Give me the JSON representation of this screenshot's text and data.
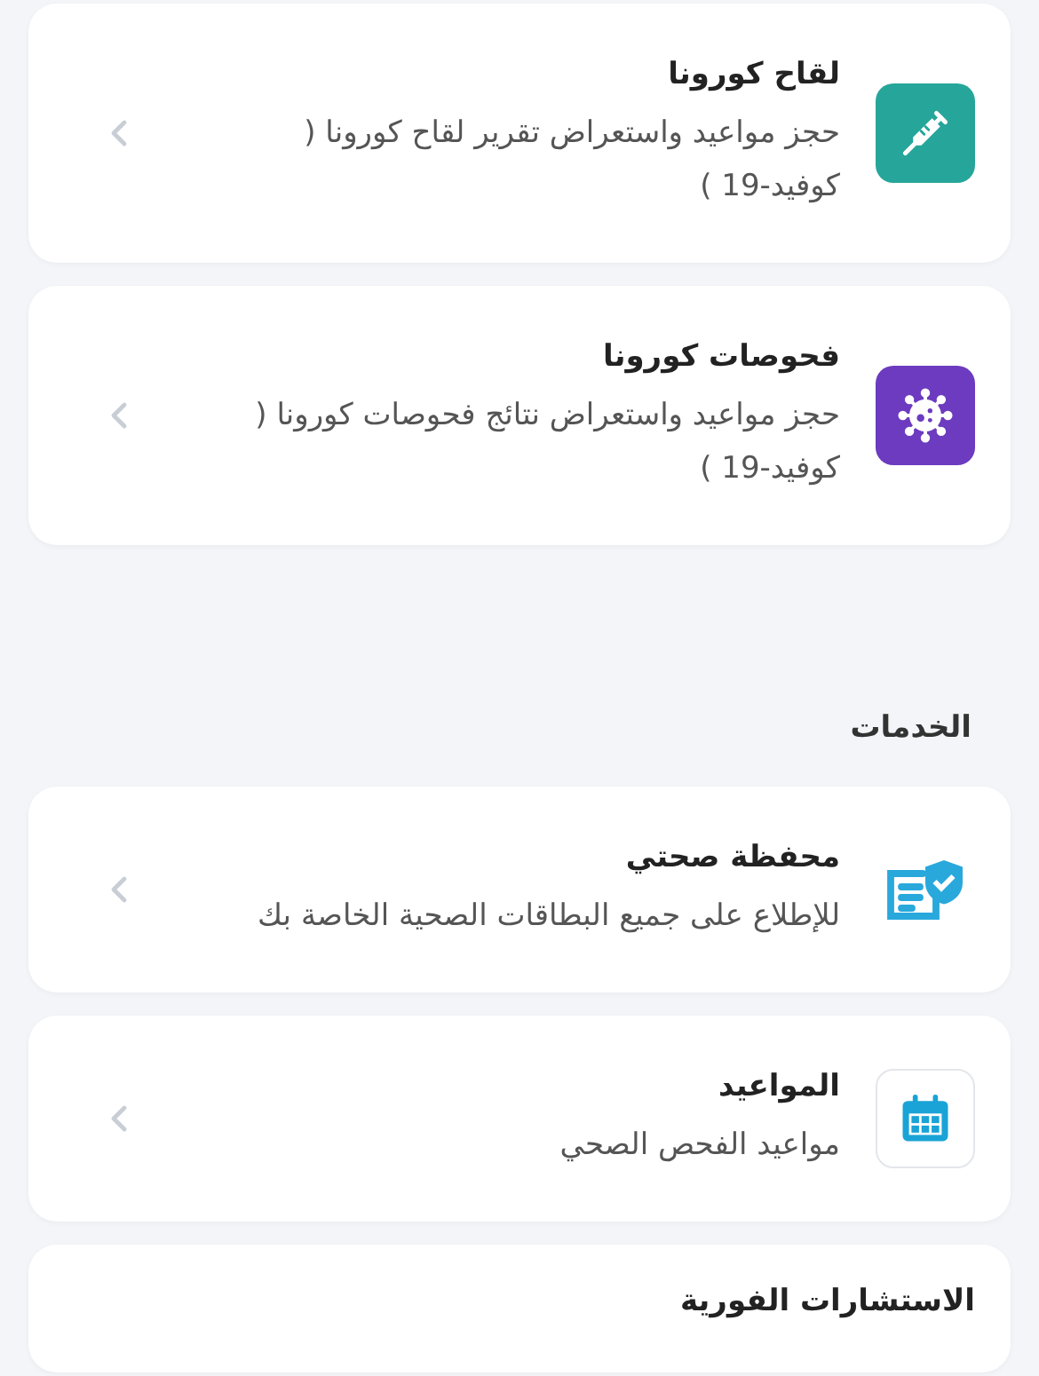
{
  "top_cards": [
    {
      "kind": "syringe",
      "title": "لقاح كورونا",
      "description": "حجز مواعيد واستعراض تقرير لقاح كورونا ( كوفيد-19 )"
    },
    {
      "kind": "virus",
      "title": "فحوصات كورونا",
      "description": "حجز مواعيد واستعراض نتائج فحوصات كورونا ( كوفيد-19 )"
    }
  ],
  "services": {
    "heading": "الخدمات",
    "cards": [
      {
        "kind": "wallet",
        "title": "محفظة صحتي",
        "description": "للإطلاع على جميع البطاقات الصحية الخاصة بك"
      },
      {
        "kind": "calendar",
        "title": "المواعيد",
        "description": "مواعيد الفحص الصحي"
      },
      {
        "kind": "consultation",
        "title": "الاستشارات الفورية"
      }
    ]
  }
}
